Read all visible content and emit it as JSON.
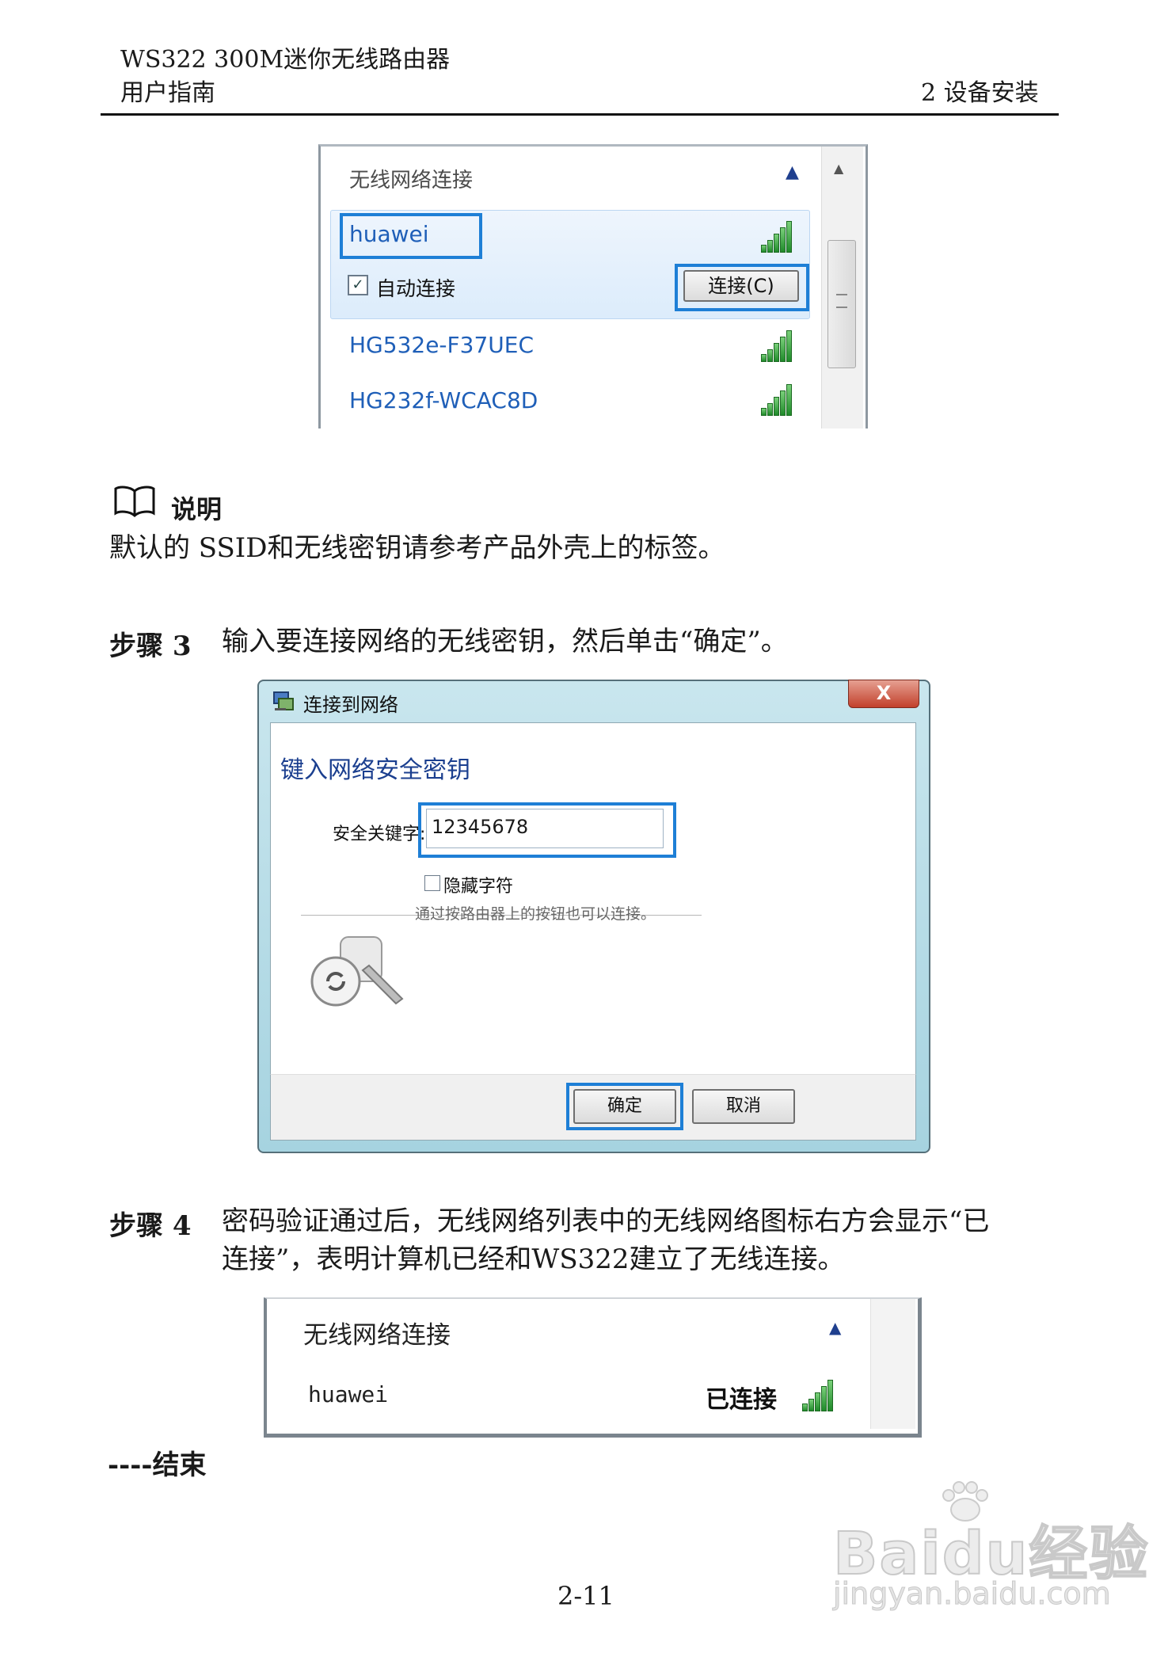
{
  "header": {
    "product": "WS322 300M迷你无线路由器",
    "doc_type": "用户指南",
    "chapter": "2 设备安装"
  },
  "wireless_list": {
    "title": "无线网络连接",
    "networks": [
      {
        "ssid": "huawei",
        "auto_connect_label": "自动连接",
        "auto_connect_checked": true,
        "connect_button": "连接(C)"
      },
      {
        "ssid": "HG532e-F37UEC"
      },
      {
        "ssid": "HG232f-WCAC8D"
      }
    ]
  },
  "note": {
    "title": "说明",
    "text": "默认的 SSID和无线密钥请参考产品外壳上的标签。"
  },
  "step3": {
    "label": "步骤 3",
    "text": "输入要连接网络的无线密钥，然后单击“确定”。"
  },
  "connect_dialog": {
    "window_title": "连接到网络",
    "close_glyph": "X",
    "heading": "键入网络安全密钥",
    "key_label": "安全关键字:",
    "key_value": "12345678",
    "hide_chars_label": "隐藏字符",
    "wps_hint": "通过按路由器上的按钮也可以连接。",
    "ok_button": "确定",
    "cancel_button": "取消"
  },
  "step4": {
    "label": "步骤 4",
    "line1": "密码验证通过后，无线网络列表中的无线网络图标右方会显示“已",
    "line2": "连接”，表明计算机已经和WS322建立了无线连接。"
  },
  "connected_list": {
    "title": "无线网络连接",
    "ssid": "huawei",
    "status": "已连接"
  },
  "end_marker": "----结束",
  "page_number": "2-11",
  "watermark": {
    "brand": "Baidu经验",
    "url": "jingyan.baidu.com"
  },
  "colors": {
    "highlight": "#1e7fd6",
    "ssid": "#1f5fb8",
    "signal": "#2a9a35"
  }
}
